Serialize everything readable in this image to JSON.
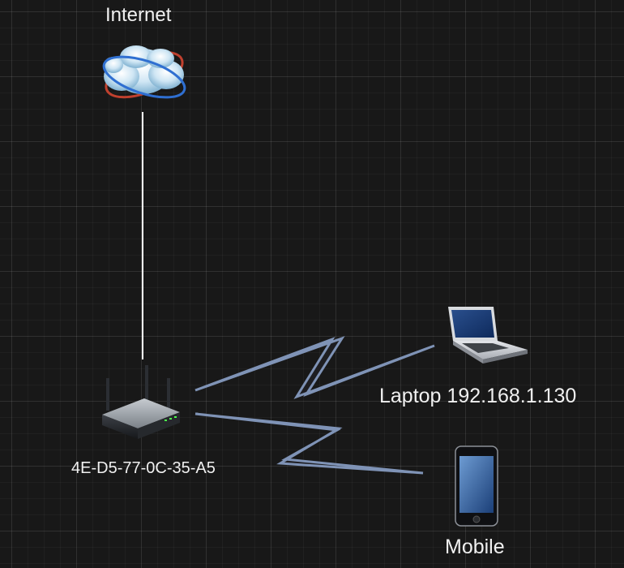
{
  "diagram": {
    "nodes": [
      {
        "id": "internet",
        "label": "Internet",
        "icon": "cloud-globe-icon"
      },
      {
        "id": "router",
        "label": "4E-D5-77-0C-35-A5",
        "icon": "wireless-router-icon"
      },
      {
        "id": "laptop",
        "label": "Laptop 192.168.1.130",
        "icon": "laptop-icon"
      },
      {
        "id": "mobile",
        "label": "Mobile",
        "icon": "smartphone-icon"
      }
    ],
    "edges": [
      {
        "from": "internet",
        "to": "router",
        "type": "wired"
      },
      {
        "from": "router",
        "to": "laptop",
        "type": "wireless"
      },
      {
        "from": "router",
        "to": "mobile",
        "type": "wireless"
      }
    ]
  },
  "colors": {
    "background": "#181818",
    "wired_link": "#ffffff",
    "wireless_fill": "#1e1e22",
    "wireless_stroke": "#7f93b6",
    "label_text": "#f0f0f0"
  }
}
